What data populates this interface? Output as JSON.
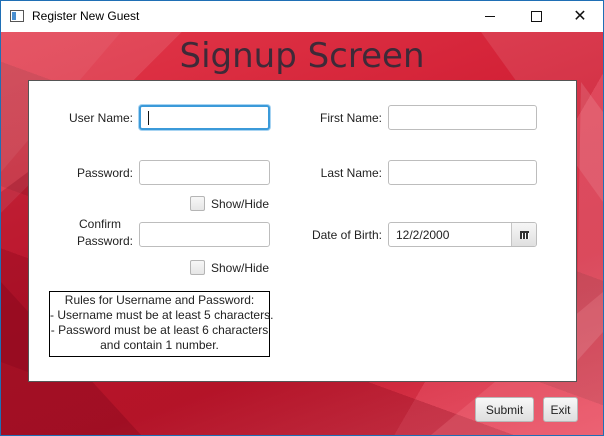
{
  "window": {
    "title": "Register New Guest"
  },
  "page": {
    "heading": "Signup Screen"
  },
  "form": {
    "username_label": "User Name:",
    "username_value": "",
    "password_label": "Password:",
    "password_value": "",
    "show_hide_1": "Show/Hide",
    "confirm_label_line1": "Confirm",
    "confirm_label_line2": "Password:",
    "confirm_value": "",
    "show_hide_2": "Show/Hide",
    "first_name_label": "First Name:",
    "first_name_value": "",
    "last_name_label": "Last Name:",
    "last_name_value": "",
    "dob_label": "Date of Birth:",
    "dob_value": "12/2/2000"
  },
  "rules": {
    "lines": [
      "Rules for Username and Password:",
      "- Username must be at least 5 characters.",
      "- Password must be at least 6 characters",
      "and contain 1 number."
    ]
  },
  "buttons": {
    "submit": "Submit",
    "exit": "Exit"
  },
  "icons": {
    "calendar": "calendar-icon",
    "minimize": "minimize-icon",
    "maximize": "maximize-icon",
    "close": "close-icon"
  },
  "colors": {
    "background_red": "#d01d33",
    "focus_blue": "#3b9ad9",
    "heading": "#3e2a38"
  }
}
